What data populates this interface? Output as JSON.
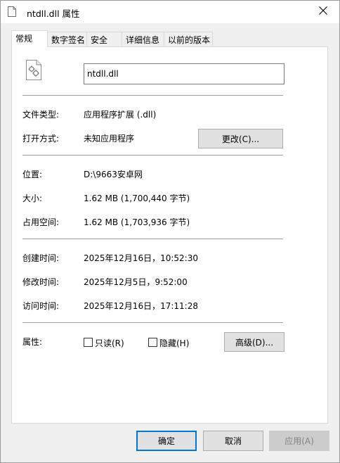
{
  "window": {
    "title": "ntdll.dll 属性",
    "title_icon": "file-icon",
    "close_icon": "close-icon"
  },
  "tabs": [
    {
      "label": "常规",
      "active": true
    },
    {
      "label": "数字签名",
      "active": false
    },
    {
      "label": "安全",
      "active": false
    },
    {
      "label": "详细信息",
      "active": false
    },
    {
      "label": "以前的版本",
      "active": false
    }
  ],
  "general": {
    "file_icon": "dll-settings-file-icon",
    "file_name": "ntdll.dll",
    "file_type_label": "文件类型:",
    "file_type_value": "应用程序扩展 (.dll)",
    "opens_with_label": "打开方式:",
    "opens_with_value": "未知应用程序",
    "change_button": "更改(C)...",
    "location_label": "位置:",
    "location_value": "D:\\9663安卓网",
    "size_label": "大小:",
    "size_value": "1.62 MB (1,700,440 字节)",
    "size_on_disk_label": "占用空间:",
    "size_on_disk_value": "1.62 MB (1,703,936 字节)",
    "created_label": "创建时间:",
    "created_value": "2025年12月16日，10:52:30",
    "modified_label": "修改时间:",
    "modified_value": "2025年12月5日，9:52:00",
    "accessed_label": "访问时间:",
    "accessed_value": "2025年12月16日，17:11:28",
    "attributes_label": "属性:",
    "readonly_label": "只读(R)",
    "readonly_checked": false,
    "hidden_label": "隐藏(H)",
    "hidden_checked": false,
    "advanced_button": "高级(D)..."
  },
  "footer": {
    "ok_button": "确定",
    "cancel_button": "取消",
    "apply_button": "应用(A)"
  },
  "colors": {
    "default_button_border": "#0078d7",
    "dialog_background": "#f0f0f0",
    "button_background": "#e1e1e1"
  }
}
